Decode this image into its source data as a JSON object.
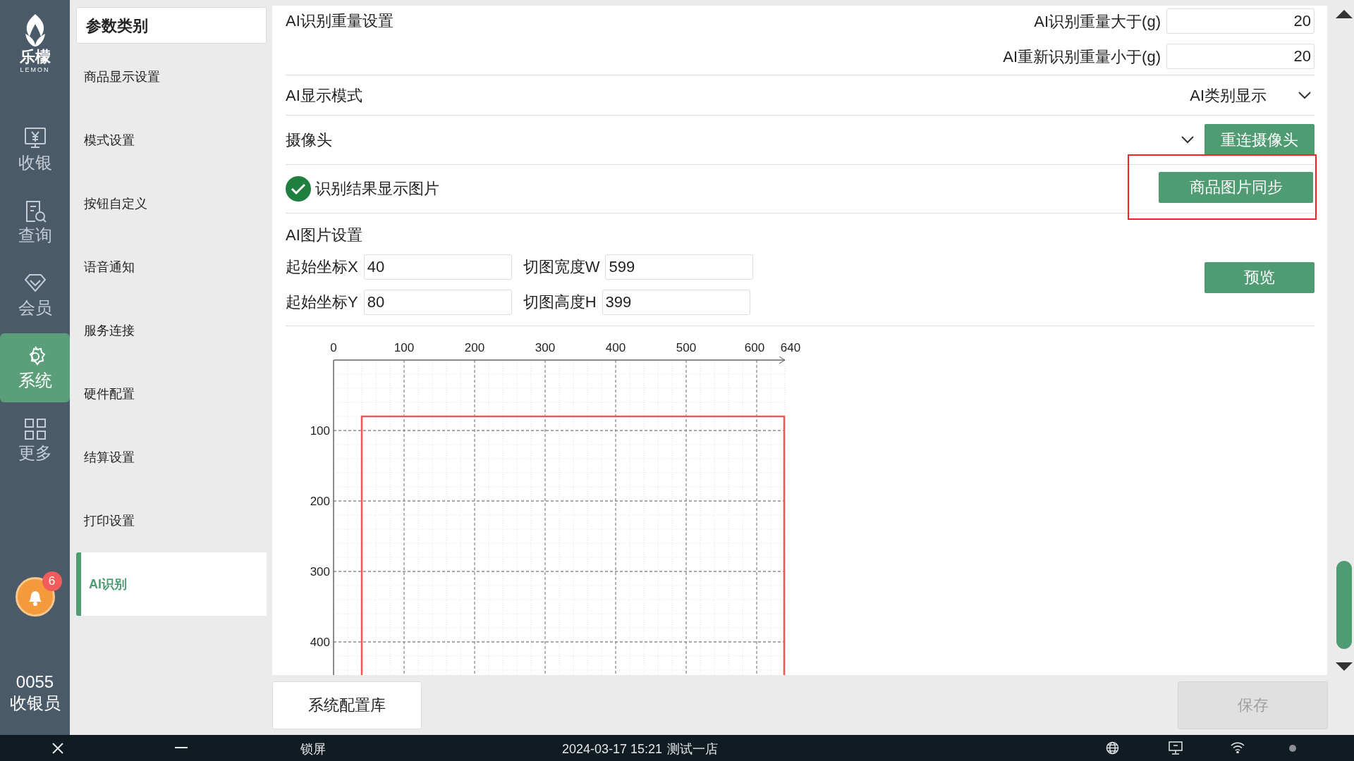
{
  "nav": {
    "logo_text": "乐檬",
    "logo_subtext": "LEMON",
    "items": [
      {
        "label": "收银",
        "kind": "cashier",
        "selected": false
      },
      {
        "label": "查询",
        "kind": "query",
        "selected": false
      },
      {
        "label": "会员",
        "kind": "member",
        "selected": false
      },
      {
        "label": "系统",
        "kind": "system",
        "selected": true
      },
      {
        "label": "更多",
        "kind": "more",
        "selected": false
      }
    ],
    "notification_count": "6",
    "operator_id": "0055",
    "operator_role": "收银员"
  },
  "categories": {
    "title": "参数类别",
    "items": [
      {
        "label": "商品显示设置",
        "selected": false
      },
      {
        "label": "模式设置",
        "selected": false
      },
      {
        "label": "按钮自定义",
        "selected": false
      },
      {
        "label": "语音通知",
        "selected": false
      },
      {
        "label": "服务连接",
        "selected": false
      },
      {
        "label": "硬件配置",
        "selected": false
      },
      {
        "label": "结算设置",
        "selected": false
      },
      {
        "label": "打印设置",
        "selected": false
      },
      {
        "label": "AI识别",
        "selected": true
      }
    ]
  },
  "settings": {
    "weight_section": {
      "title": "AI识别重量设置",
      "fields": [
        {
          "label": "AI识别重量大于(g)",
          "value": "20"
        },
        {
          "label": "AI重新识别重量小于(g)",
          "value": "20"
        }
      ]
    },
    "display_mode": {
      "label": "AI显示模式",
      "value": "AI类别显示"
    },
    "camera": {
      "label": "摄像头",
      "button": "重连摄像头"
    },
    "show_image": {
      "label": "识别结果显示图片",
      "checked": true,
      "button": "商品图片同步",
      "highlighted": true
    },
    "image_section": {
      "title": "AI图片设置",
      "fields": [
        {
          "label": "起始坐标X",
          "value": "40"
        },
        {
          "label": "切图宽度W",
          "value": "599"
        },
        {
          "label": "起始坐标Y",
          "value": "80"
        },
        {
          "label": "切图高度H",
          "value": "399"
        }
      ],
      "button": "预览"
    },
    "preview": {
      "x_ticks": [
        "0",
        "100",
        "200",
        "300",
        "400",
        "500",
        "600",
        "640"
      ],
      "y_ticks": [
        "100",
        "200",
        "300",
        "400"
      ]
    }
  },
  "footer": {
    "library_button": "系统配置库",
    "save_button": "保存",
    "save_disabled": true
  },
  "taskbar": {
    "lock": "锁屏",
    "datetime": "2024-03-17 15:21",
    "store": "测试一店"
  }
}
